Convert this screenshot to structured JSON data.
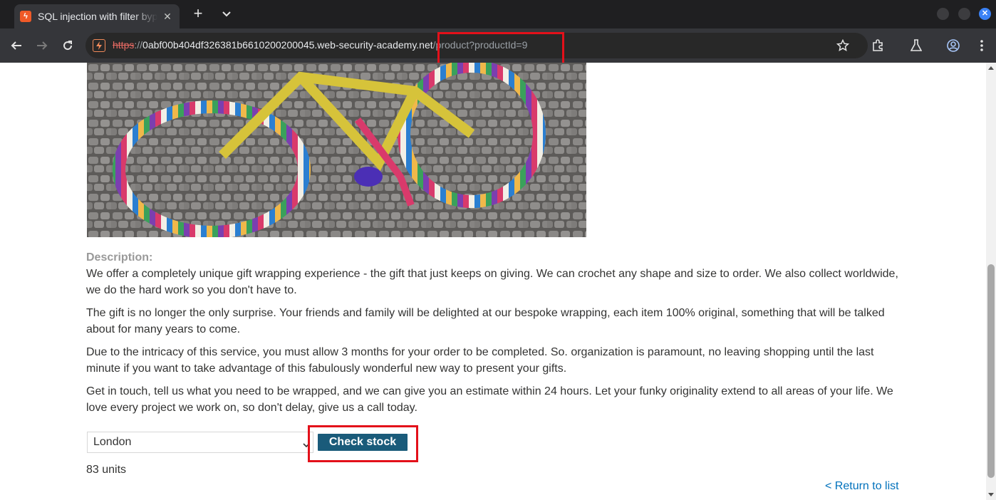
{
  "browser": {
    "tab": {
      "title": "SQL injection with filter bypass via XML encoding",
      "favicon": "burp-lightning-icon",
      "close_glyph": "✕"
    },
    "new_tab_glyph": "+",
    "address": {
      "scheme": "https",
      "separator": "://",
      "host": "0abf00b404df326381b6610200200045.web-security-academy.net",
      "path": "/product?productId=9"
    },
    "window_close_glyph": "✕"
  },
  "page": {
    "product_image_alt": "yarn-bombed bicycle",
    "description_label": "Description:",
    "description_paragraphs": [
      "We offer a completely unique gift wrapping experience - the gift that just keeps on giving. We can crochet any shape and size to order. We also collect worldwide, we do the hard work so you don't have to.",
      "The gift is no longer the only surprise. Your friends and family will be delighted at our bespoke wrapping, each item 100% original, something that will be talked about for many years to come.",
      "Due to the intricacy of this service, you must allow 3 months for your order to be completed. So. organization is paramount, no leaving shopping until the last minute if you want to take advantage of this fabulously wonderful new way to present your gifts.",
      "Get in touch, tell us what you need to be wrapped, and we can give you an estimate within 24 hours. Let your funky originality extend to all areas of your life. We love every project we work on, so don't delay, give us a call today."
    ],
    "stock": {
      "selected_store": "London",
      "check_button": "Check stock",
      "result": "83 units"
    },
    "return_link": "< Return to list"
  },
  "colors": {
    "highlight": "#e3101a",
    "button": "#1a5b7a",
    "link": "#0071bc"
  }
}
